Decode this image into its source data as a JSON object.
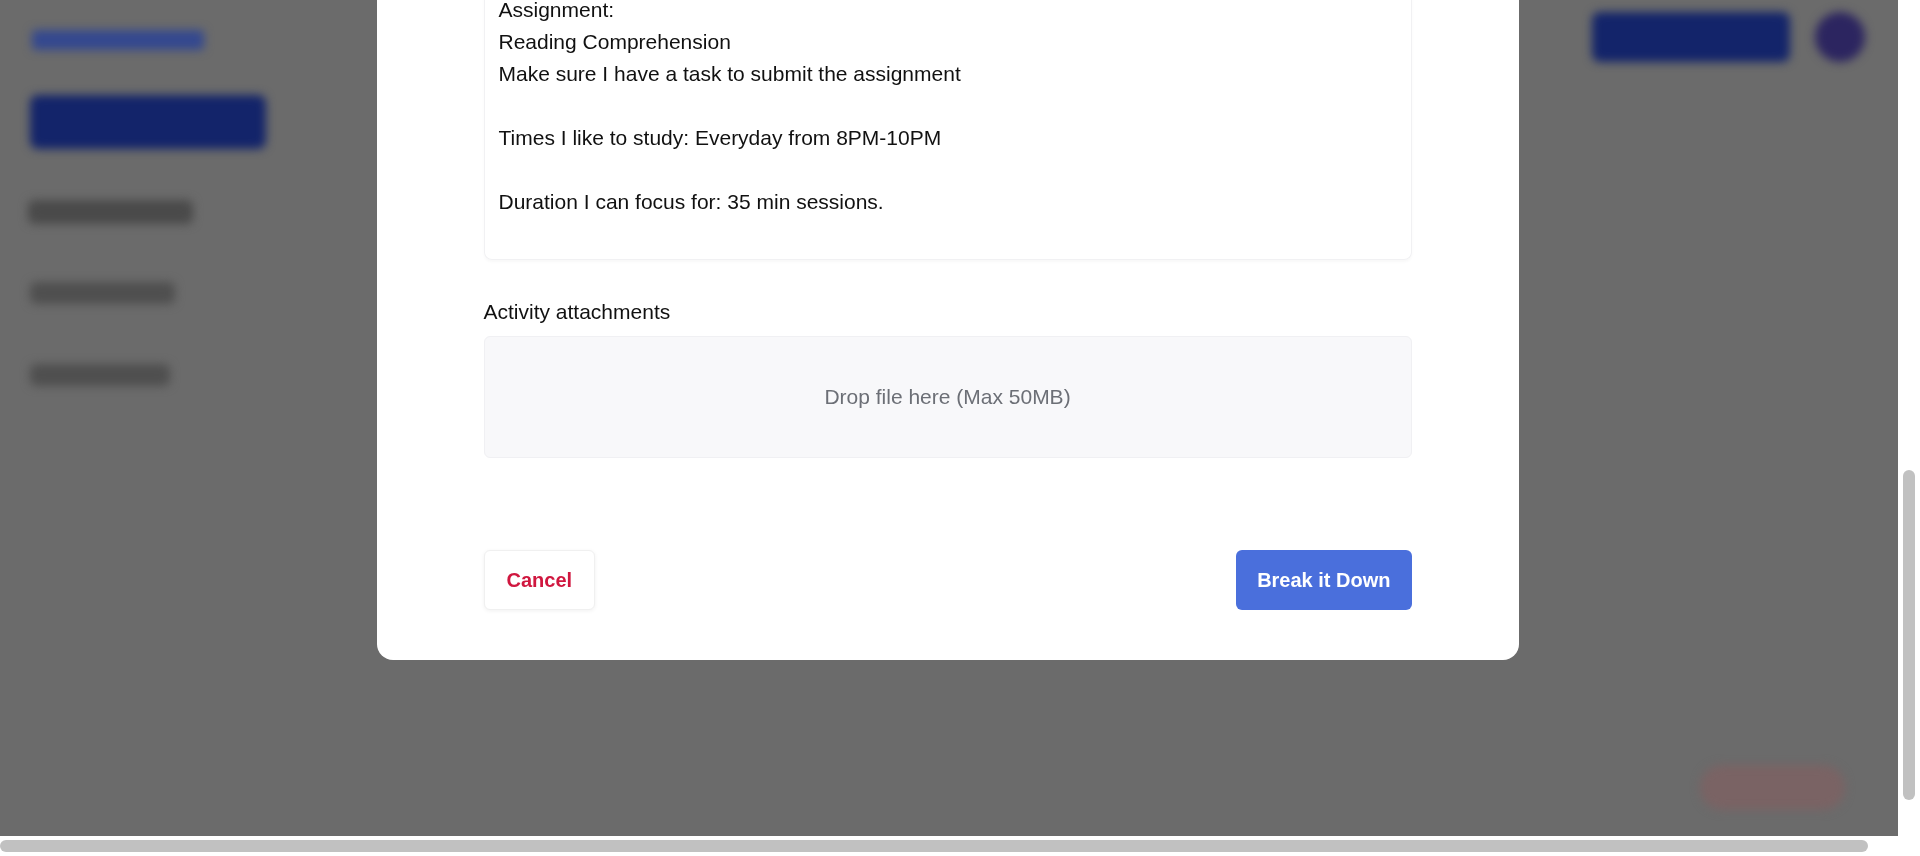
{
  "activity_description": {
    "paragraphs": [
      [
        "Assignment:",
        "Reading Comprehension",
        "Make sure I have a task to submit the assignment"
      ],
      [
        "Times I like to study: Everyday from 8PM-10PM"
      ],
      [
        "Duration I can focus for: 35 min sessions."
      ]
    ]
  },
  "attachments": {
    "label": "Activity attachments",
    "dropzone": "Drop file here (Max 50MB)"
  },
  "buttons": [
    {
      "label": "Cancel",
      "kind": "cancel"
    },
    {
      "label": "Break it Down",
      "kind": "primary"
    }
  ]
}
